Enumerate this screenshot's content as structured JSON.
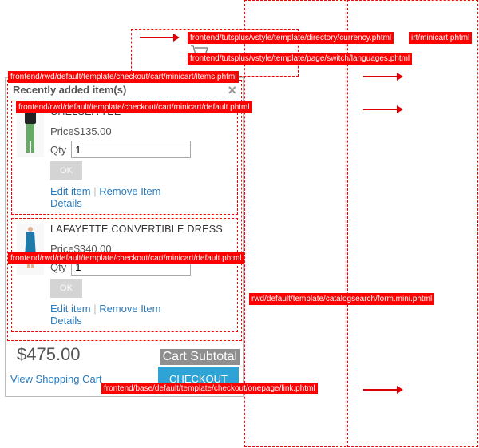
{
  "top_hints": {
    "currency": "frontend/tutsplus/vstyle/template/directory/currency.phtml",
    "currency_right": "irt/minicart.phtml",
    "languages": "frontend/tutsplus/vstyle/template/page/switch/languages.phtml"
  },
  "minicart": {
    "items_hint": "frontend/rwd/default/template/checkout/cart/minicart/items.phtml",
    "default_hint": "frontend/rwd/default/template/checkout/cart/minicart/default.phtml",
    "title": "Recently added item(s)",
    "items": [
      {
        "name": "CHELSEA TEE",
        "price_label": "Price",
        "currency": "$",
        "price": "135.00",
        "qty_label": "Qty",
        "qty": "1",
        "ok": "OK",
        "edit": "Edit item",
        "sep": " | ",
        "remove": "Remove Item",
        "details": "Details"
      },
      {
        "name": "LAFAYETTE CONVERTIBLE DRESS",
        "price_label": "Price",
        "currency": "$",
        "price": "340.00",
        "qty_label": "Qty",
        "qty": "1",
        "ok": "OK",
        "edit": "Edit item",
        "sep": " | ",
        "remove": "Remove Item",
        "details": "Details"
      }
    ],
    "subtotal_hint": "frontend/base/default/template/checkout/onepage/link.phtml",
    "subtotal_label": "Cart Subtotal",
    "subtotal_currency": "$",
    "subtotal": "475.00",
    "view_cart": "View Shopping Cart",
    "checkout": "CHECKOUT"
  },
  "search_hint": "rwd/default/template/catalogsearch/form.mini.phtml"
}
